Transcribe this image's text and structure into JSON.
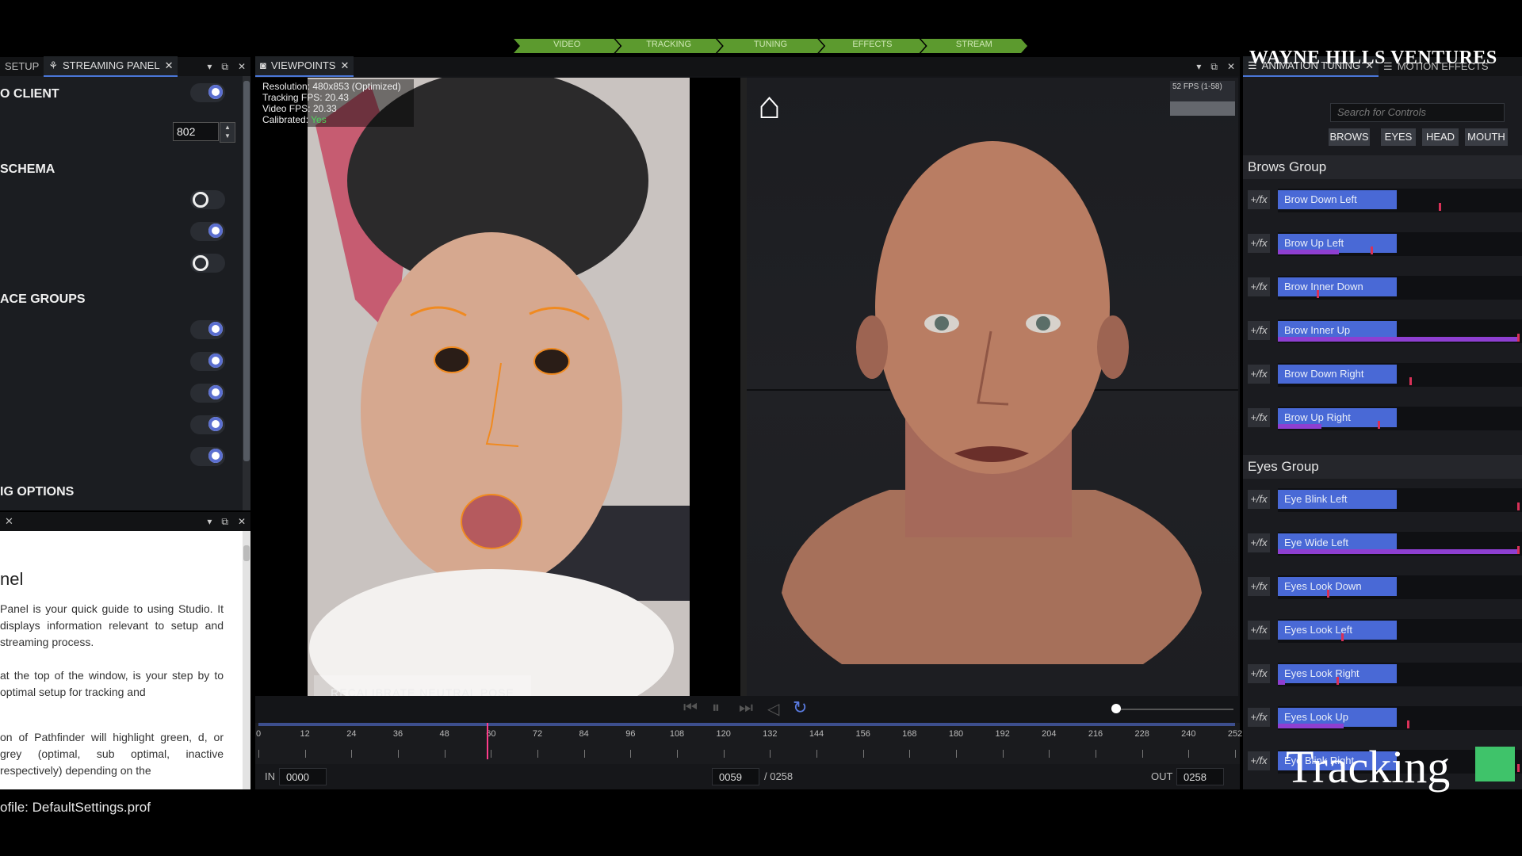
{
  "pathfinder": {
    "steps": [
      "VIDEO",
      "TRACKING",
      "TUNING",
      "EFFECTS",
      "STREAM"
    ]
  },
  "left_panel": {
    "tabs": [
      {
        "label": "SETUP"
      },
      {
        "label": "STREAMING PANEL"
      }
    ],
    "sections": {
      "client": "O CLIENT",
      "schema": "SCHEMA",
      "face_groups": "ACE GROUPS",
      "options": "IG OPTIONS"
    },
    "port_value": "802"
  },
  "help_panel": {
    "title": "nel",
    "paragraphs": [
      "Panel is your quick guide to using Studio. It displays information relevant to setup and streaming process.",
      "at the top of the window, is your step by to optimal setup for tracking and",
      "on of Pathfinder will highlight green, d, or grey (optimal, sub optimal, inactive respectively) depending on the"
    ]
  },
  "viewports": {
    "tab_label": "VIEWPOINTS",
    "video_stats": {
      "resolution": "Resolution: 480x853 (Optimized)",
      "tracking_fps": "Tracking FPS: 20.43",
      "video_fps": "Video FPS: 20.33",
      "calibrated_label": "Calibrated: ",
      "calibrated_value": "Yes"
    },
    "recalibrate_label": "RECALIBRATE NEUTRAL POSE",
    "fps_graph_label": "52 FPS (1-58)",
    "timeline": {
      "ticks": [
        "0",
        "12",
        "24",
        "36",
        "48",
        "60",
        "72",
        "84",
        "96",
        "108",
        "120",
        "132",
        "144",
        "156",
        "168",
        "180",
        "192",
        "204",
        "216",
        "228",
        "240",
        "252"
      ],
      "in_label": "IN",
      "in_value": "0000",
      "current_frame": "0059",
      "total_frames": "/ 0258",
      "out_label": "OUT",
      "out_value": "0258",
      "playhead_frame": 59,
      "max_frame": 252
    }
  },
  "right_panel": {
    "tabs": [
      {
        "label": "ANIMATION TUNING"
      },
      {
        "label": "MOTION EFFECTS"
      }
    ],
    "search_placeholder": "Search for Controls",
    "filters": [
      "BROWS",
      "EYES",
      "HEAD",
      "MOUTH"
    ],
    "groups": [
      {
        "title": "Brows Group",
        "controls": [
          {
            "fx": "+/fx",
            "label": "Brow Down Left",
            "value": 0.0,
            "marker": 0.67
          },
          {
            "fx": "+/fx",
            "label": "Brow Up Left",
            "value": 0.25,
            "marker": 0.39
          },
          {
            "fx": "+/fx",
            "label": "Brow Inner Down",
            "value": 0.0,
            "marker": 0.17
          },
          {
            "fx": "+/fx",
            "label": "Brow Inner Up",
            "value": 0.99,
            "marker": 0.99
          },
          {
            "fx": "+/fx",
            "label": "Brow Down Right",
            "value": 0.0,
            "marker": 0.55
          },
          {
            "fx": "+/fx",
            "label": "Brow Up Right",
            "value": 0.18,
            "marker": 0.42
          }
        ]
      },
      {
        "title": "Eyes Group",
        "controls": [
          {
            "fx": "+/fx",
            "label": "Eye Blink Left",
            "value": 0.0,
            "marker": 0.99
          },
          {
            "fx": "+/fx",
            "label": "Eye Wide Left",
            "value": 0.99,
            "marker": 0.99
          },
          {
            "fx": "+/fx",
            "label": "Eyes Look Down",
            "value": 0.0,
            "marker": 0.21
          },
          {
            "fx": "+/fx",
            "label": "Eyes Look Left",
            "value": 0.0,
            "marker": 0.27
          },
          {
            "fx": "+/fx",
            "label": "Eyes Look Right",
            "value": 0.03,
            "marker": 0.25
          },
          {
            "fx": "+/fx",
            "label": "Eyes Look Up",
            "value": 0.27,
            "marker": 0.54
          },
          {
            "fx": "+/fx",
            "label": "Eye Blink Right",
            "value": 0.0,
            "marker": 0.99
          }
        ]
      }
    ]
  },
  "status_bar": {
    "text": "ofile: DefaultSettings.prof"
  },
  "watermark": {
    "top": "WAYNE HILLS  VENTURES",
    "bottom": "Tracking"
  },
  "colors": {
    "accent": "#4969d6",
    "pathfinder_green": "#5c9a2e",
    "playhead": "#ff3c8a",
    "fill": "#8e3fd1"
  }
}
